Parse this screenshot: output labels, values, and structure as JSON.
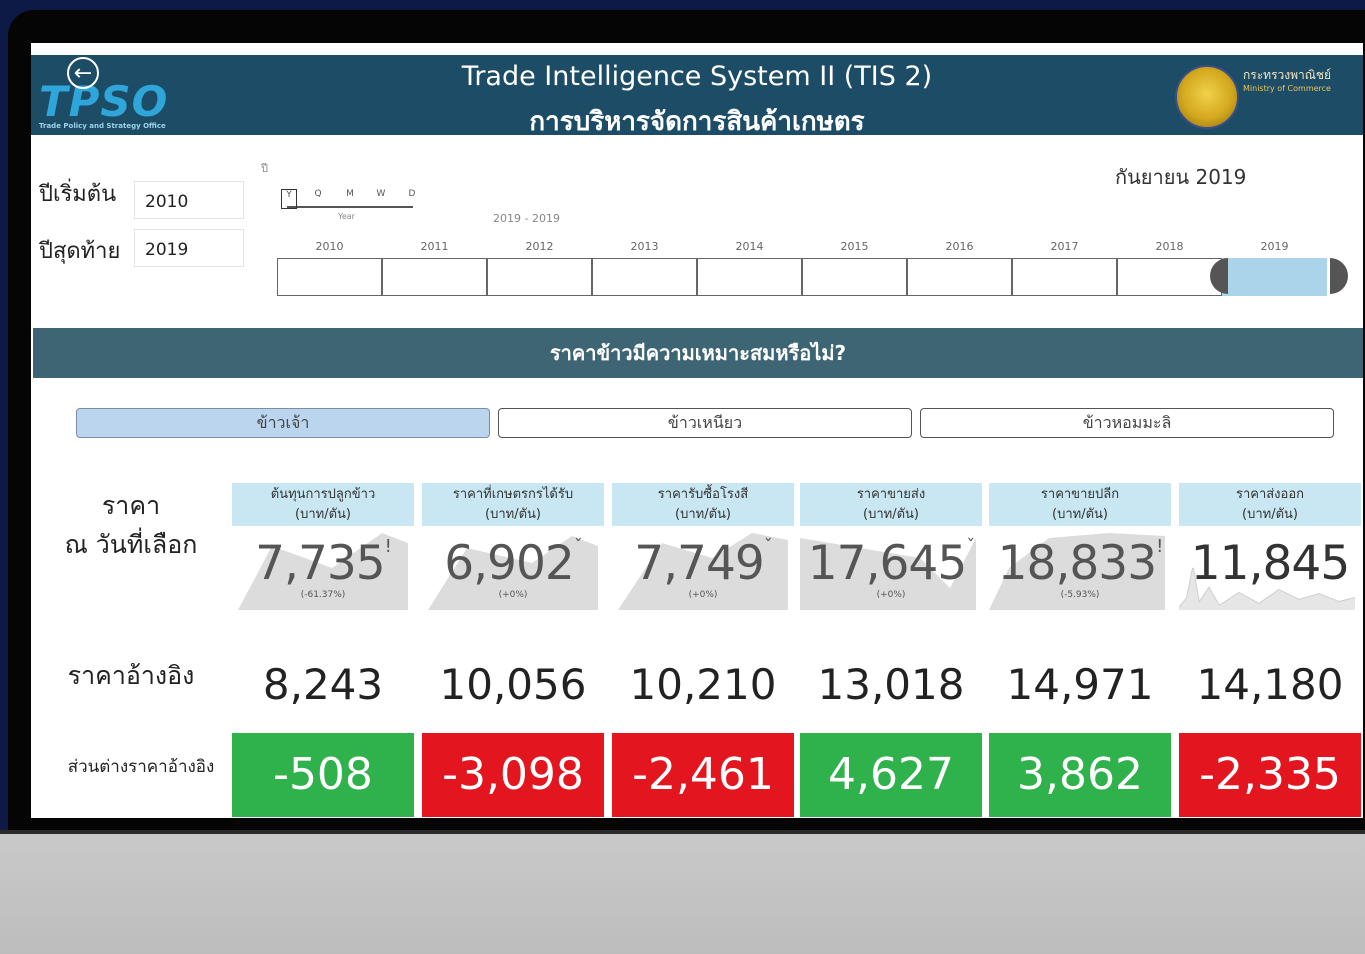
{
  "header": {
    "logo": "TPSO",
    "logo_sub": "Trade Policy and Strategy Office",
    "title": "Trade Intelligence System II (TIS 2)",
    "subtitle": "การบริหารจัดการสินค้าเกษตร",
    "ministry_th": "กระทรวงพาณิชย์",
    "ministry_en": "Ministry of Commerce",
    "back_icon": "arrow-left-circle-icon"
  },
  "filters": {
    "start_label": "ปีเริ่มต้น",
    "start_value": "2010",
    "end_label": "ปีสุดท้าย",
    "end_value": "2019",
    "timeline_caption": "ปี",
    "granularity_options": [
      "Y",
      "Q",
      "M",
      "W",
      "D"
    ],
    "granularity_selected_caption": "Year",
    "range_label": "2019 - 2019",
    "selected_month": "กันยายน 2019",
    "years": [
      "2010",
      "2011",
      "2012",
      "2013",
      "2014",
      "2015",
      "2016",
      "2017",
      "2018",
      "2019"
    ],
    "selected_year": "2019"
  },
  "banner": "ราคาข้าวมีความเหมาะสมหรือไม่?",
  "tabs": [
    {
      "label": "ข้าวเจ้า",
      "active": true
    },
    {
      "label": "ข้าวเหนียว",
      "active": false
    },
    {
      "label": "ข้าวหอมมะลิ",
      "active": false
    }
  ],
  "row_labels": {
    "price_line1": "ราคา",
    "price_line2": "ณ วันที่เลือก",
    "reference": "ราคาอ้างอิง",
    "difference": "ส่วนต่างราคาอ้างอิง"
  },
  "cards": [
    {
      "head1": "ต้นทุนการปลูกข้าว",
      "head2": "(บาท/ตัน)",
      "price": "7,735",
      "suffix": "!",
      "pct": "(-61.37%)",
      "reference": "8,243",
      "diff": "-508",
      "diff_color": "#2fb24c"
    },
    {
      "head1": "ราคาที่เกษตรกรได้รับ",
      "head2": "(บาท/ตัน)",
      "price": "6,902",
      "suffix": "ˇ",
      "pct": "(+0%)",
      "reference": "10,056",
      "diff": "-3,098",
      "diff_color": "#e3161f"
    },
    {
      "head1": "ราคารับซื้อโรงสี",
      "head2": "(บาท/ตัน)",
      "price": "7,749",
      "suffix": "ˇ",
      "pct": "(+0%)",
      "reference": "10,210",
      "diff": "-2,461",
      "diff_color": "#e3161f"
    },
    {
      "head1": "ราคาขายส่ง",
      "head2": "(บาท/ตัน)",
      "price": "17,645",
      "suffix": "ˇ",
      "pct": "(+0%)",
      "reference": "13,018",
      "diff": "4,627",
      "diff_color": "#2fb24c"
    },
    {
      "head1": "ราคาขายปลีก",
      "head2": "(บาท/ตัน)",
      "price": "18,833",
      "suffix": "!",
      "pct": "(-5.93%)",
      "reference": "14,971",
      "diff": "3,862",
      "diff_color": "#2fb24c"
    },
    {
      "head1": "ราคาส่งออก",
      "head2": "(บาท/ตัน)",
      "price": "11,845",
      "suffix": "",
      "pct": "",
      "reference": "14,180",
      "diff": "-2,335",
      "diff_color": "#e3161f"
    }
  ]
}
